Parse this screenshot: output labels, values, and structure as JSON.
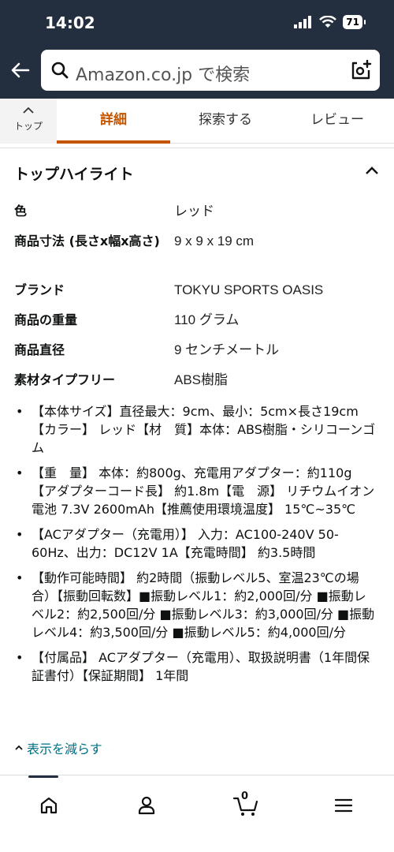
{
  "status_bar": {
    "time": "14:02",
    "battery": "71"
  },
  "search": {
    "placeholder": "Amazon.co.jp で検索"
  },
  "tabs": {
    "top_label": "トップ",
    "items": [
      {
        "label": "詳細",
        "active": true
      },
      {
        "label": "探索する",
        "active": false
      },
      {
        "label": "レビュー",
        "active": false
      }
    ]
  },
  "highlights": {
    "title": "トップハイライト",
    "specs": [
      {
        "label": "色",
        "value": "レッド"
      },
      {
        "label": "商品寸法 (長さx幅x高さ)",
        "value": "9 x 9 x 19 cm"
      },
      {
        "label": "ブランド",
        "value": "TOKYU SPORTS OASIS"
      },
      {
        "label": "商品の重量",
        "value": "110 グラム"
      },
      {
        "label": "商品直径",
        "value": "9 センチメートル"
      },
      {
        "label": "素材タイプフリー",
        "value": "ABS樹脂"
      }
    ],
    "bullets": [
      "【本体サイズ】直径最大：9cm、最小：5cm×長さ19cm【カラー】 レッド【材　質】本体：ABS樹脂・シリコーンゴム",
      "【重　量】 本体：約800g、充電用アダプター：約110g【アダプターコード長】 約1.8m【電　源】 リチウムイオン電池 7.3V 2600mAh【推薦使用環境温度】 15℃~35℃",
      "【ACアダプター（充電用）】 入力：AC100-240V 50-60Hz、出力：DC12V 1A【充電時間】 約3.5時間",
      "【動作可能時間】 約2時間（振動レベル5、室温23℃の場合）【振動回転数】■振動レベル1：約2,000回/分 ■振動レベル2：約2,500回/分 ■振動レベル3：約3,000回/分 ■振動レベル4：約3,500回/分 ■振動レベル5：約4,000回/分",
      "【付属品】 ACアダプター（充電用）、取扱説明書（1年間保証書付）【保証期間】 1年間"
    ],
    "show_less": "表示を減らす"
  },
  "bottom_nav": {
    "cart_count": "0"
  },
  "colors": {
    "header_bg": "#232f3e",
    "accent": "#c45500",
    "link": "#007185"
  }
}
